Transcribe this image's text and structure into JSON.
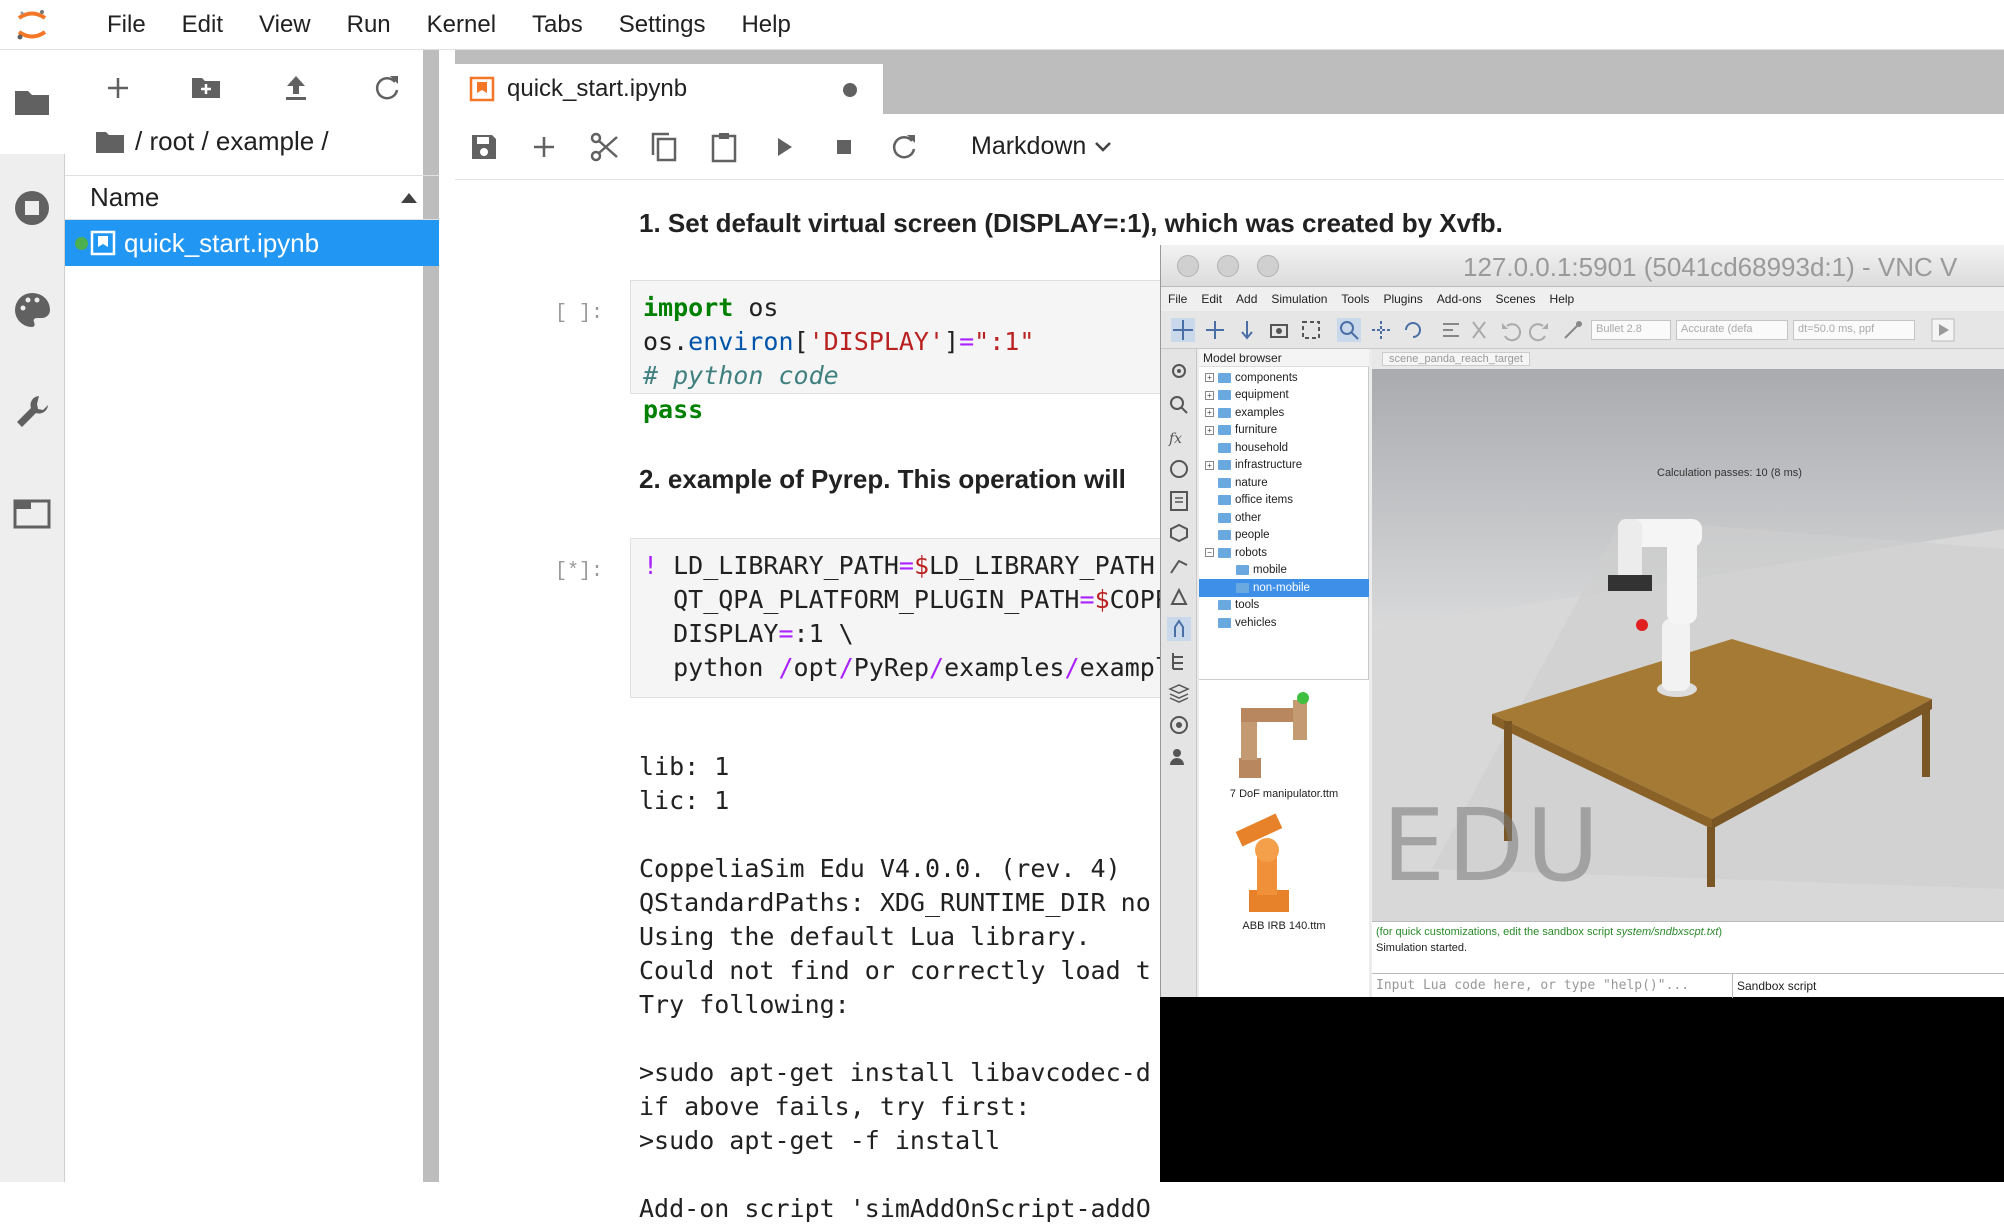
{
  "menubar": {
    "items": [
      "File",
      "Edit",
      "View",
      "Run",
      "Kernel",
      "Tabs",
      "Settings",
      "Help"
    ]
  },
  "file_browser": {
    "breadcrumb": "/ root / example /",
    "column_name": "Name",
    "files": [
      {
        "name": "quick_start.ipynb",
        "running": true
      }
    ]
  },
  "notebook": {
    "tab_label": "quick_start.ipynb",
    "cell_type": "Markdown",
    "md1": "1. Set default virtual screen (DISPLAY=:1), which was created by Xvfb.",
    "md2": "2. example of Pyrep. This operation will",
    "prompt1": "[ ]:",
    "prompt2": "[*]:",
    "output": "lib: 1\nlic: 1\n\nCoppeliaSim Edu V4.0.0. (rev. 4)\nQStandardPaths: XDG_RUNTIME_DIR no\nUsing the default Lua library.\nCould not find or correctly load t\nTry following:\n\n>sudo apt-get install libavcodec-d\nif above fails, try first:\n>sudo apt-get -f install\n\nAdd-on script 'simAddOnScript-addO"
  },
  "vnc": {
    "title": "127.0.0.1:5901 (5041cd68993d:1) - VNC V",
    "menu": [
      "File",
      "Edit",
      "Add",
      "Simulation",
      "Tools",
      "Plugins",
      "Add-ons",
      "Scenes",
      "Help"
    ],
    "engine": "Bullet 2.8",
    "accuracy": "Accurate (defa",
    "dt": "dt=50.0 ms, ppf",
    "model_browser_title": "Model browser",
    "tree": [
      {
        "label": "components",
        "expander": "+",
        "indent": 0
      },
      {
        "label": "equipment",
        "expander": "+",
        "indent": 0
      },
      {
        "label": "examples",
        "expander": "+",
        "indent": 0
      },
      {
        "label": "furniture",
        "expander": "+",
        "indent": 0
      },
      {
        "label": "household",
        "expander": "",
        "indent": 0
      },
      {
        "label": "infrastructure",
        "expander": "+",
        "indent": 0
      },
      {
        "label": "nature",
        "expander": "",
        "indent": 0
      },
      {
        "label": "office items",
        "expander": "",
        "indent": 0
      },
      {
        "label": "other",
        "expander": "",
        "indent": 0
      },
      {
        "label": "people",
        "expander": "",
        "indent": 0
      },
      {
        "label": "robots",
        "expander": "−",
        "indent": 0
      },
      {
        "label": "mobile",
        "expander": "",
        "indent": 1
      },
      {
        "label": "non-mobile",
        "expander": "",
        "indent": 1,
        "selected": true
      },
      {
        "label": "tools",
        "expander": "",
        "indent": 0
      },
      {
        "label": "vehicles",
        "expander": "",
        "indent": 0
      }
    ],
    "thumb1": "7 DoF manipulator.ttm",
    "thumb2": "ABB IRB 140.ttm",
    "scene_tab": "scene_panda_reach_target",
    "calc_passes": "Calculation passes: 10 (8 ms)",
    "watermark": "EDU",
    "status_hint_prefix": "(for quick customizations, edit the sandbox script ",
    "status_hint_path": "system/sndbxscpt.txt",
    "status_hint_suffix": ")",
    "status_line2": "Simulation started.",
    "lua_placeholder": "Input Lua code here, or type \"help()\"...",
    "sandbox_label": "Sandbox script"
  }
}
